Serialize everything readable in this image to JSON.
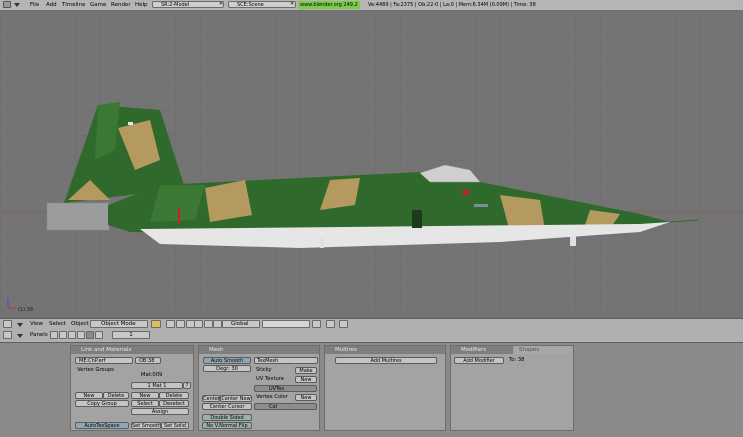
{
  "menubar": {
    "items": [
      "File",
      "Add",
      "Timeline",
      "Game",
      "Render",
      "Help"
    ],
    "screen": "SR:2-Model",
    "scene": "SCE:Scene",
    "url": "www.blender.org 249.2",
    "stats": "Ve:4489 | Fa:2375 | Ob:22-0 | La:0 | Mem:6.34M (0.09M) | Time: 38"
  },
  "viewport": {
    "frame_label": "(1) 38",
    "colors": {
      "bg": "#747474",
      "grid": "#6a6a6a",
      "green": "#2f6a2c",
      "tan": "#b59a5f",
      "white": "#e6e6e6"
    }
  },
  "view3d_header": {
    "menus": [
      "View",
      "Select",
      "Object"
    ],
    "mode": "Object Mode",
    "orientation": "Global"
  },
  "buttons_header": {
    "panels_label": "Panels",
    "frame": "1"
  },
  "link_materials": {
    "title": "Link and Materials",
    "me_name": "ME:ChP.erf",
    "ob_name": "OB:38",
    "vertex_groups": "Vertex Groups",
    "mat_name": "Mat:009",
    "mat_counter": "1 Mat 1",
    "question": "?",
    "new": "New",
    "delete": "Delete",
    "copy_group": "Copy Group",
    "mat_new": "New",
    "mat_delete": "Delete",
    "select": "Select",
    "deselect": "Deselect",
    "assign": "Assign",
    "autotexspace": "AutoTexSpace",
    "set_smooth": "Set Smooth",
    "set_solid": "Set Solid"
  },
  "mesh": {
    "title": "Mesh",
    "auto_smooth": "Auto Smooth",
    "degr": "Degr: 30",
    "texmesh": "TexMesh",
    "sticky": "Sticky",
    "make": "Make",
    "uv_texture": "UV Texture",
    "uv_new": "New",
    "uvtex_name": "UVTex",
    "vertex_color": "Vertex Color",
    "vc_new": "New",
    "col_name": "Col",
    "center": "Center",
    "center_new": "Center New",
    "center_cursor": "Center Cursor",
    "double_sided": "Double Sided",
    "no_v_normal_flip": "No V.Normal Flip"
  },
  "multires": {
    "title": "Multires",
    "add_multires": "Add Multires"
  },
  "modifiers": {
    "tab_modifiers": "Modifiers",
    "tab_shapes": "Shapes",
    "add_modifier": "Add Modifier",
    "to": "To: 38"
  }
}
